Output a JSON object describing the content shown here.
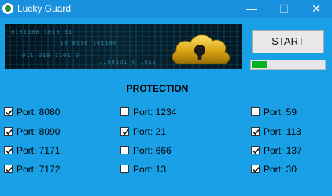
{
  "window": {
    "title": "Lucky Guard",
    "controls": {
      "minimize": "—",
      "maximize": "☐",
      "close": "✕"
    }
  },
  "banner": {
    "decorative_digits": [
      "0101100 1010 01",
      "10 0110 101100",
      "011 010 1101 0",
      "1100101 0 1011"
    ]
  },
  "actions": {
    "start_label": "START",
    "progress_fraction": 0.22
  },
  "section": {
    "heading": "PROTECTION"
  },
  "ports": {
    "col1": [
      {
        "label": "Port: 8080",
        "checked": true
      },
      {
        "label": "Port: 8090",
        "checked": true
      },
      {
        "label": "Port: 7171",
        "checked": true
      },
      {
        "label": "Port: 7172",
        "checked": true
      }
    ],
    "col2": [
      {
        "label": "Port: 1234",
        "checked": false
      },
      {
        "label": "Port: 21",
        "checked": true
      },
      {
        "label": "Port: 666",
        "checked": false
      },
      {
        "label": "Port: 13",
        "checked": false
      }
    ],
    "col3": [
      {
        "label": "Port: 59",
        "checked": false
      },
      {
        "label": "Port: 113",
        "checked": true
      },
      {
        "label": "Port: 137",
        "checked": true
      },
      {
        "label": "Port: 30",
        "checked": true
      }
    ]
  },
  "colors": {
    "window_bg": "#1aa0e6",
    "titlebar": "#1890de",
    "progress_fill": "#06b025",
    "cloud_gold": "#d9a514"
  }
}
